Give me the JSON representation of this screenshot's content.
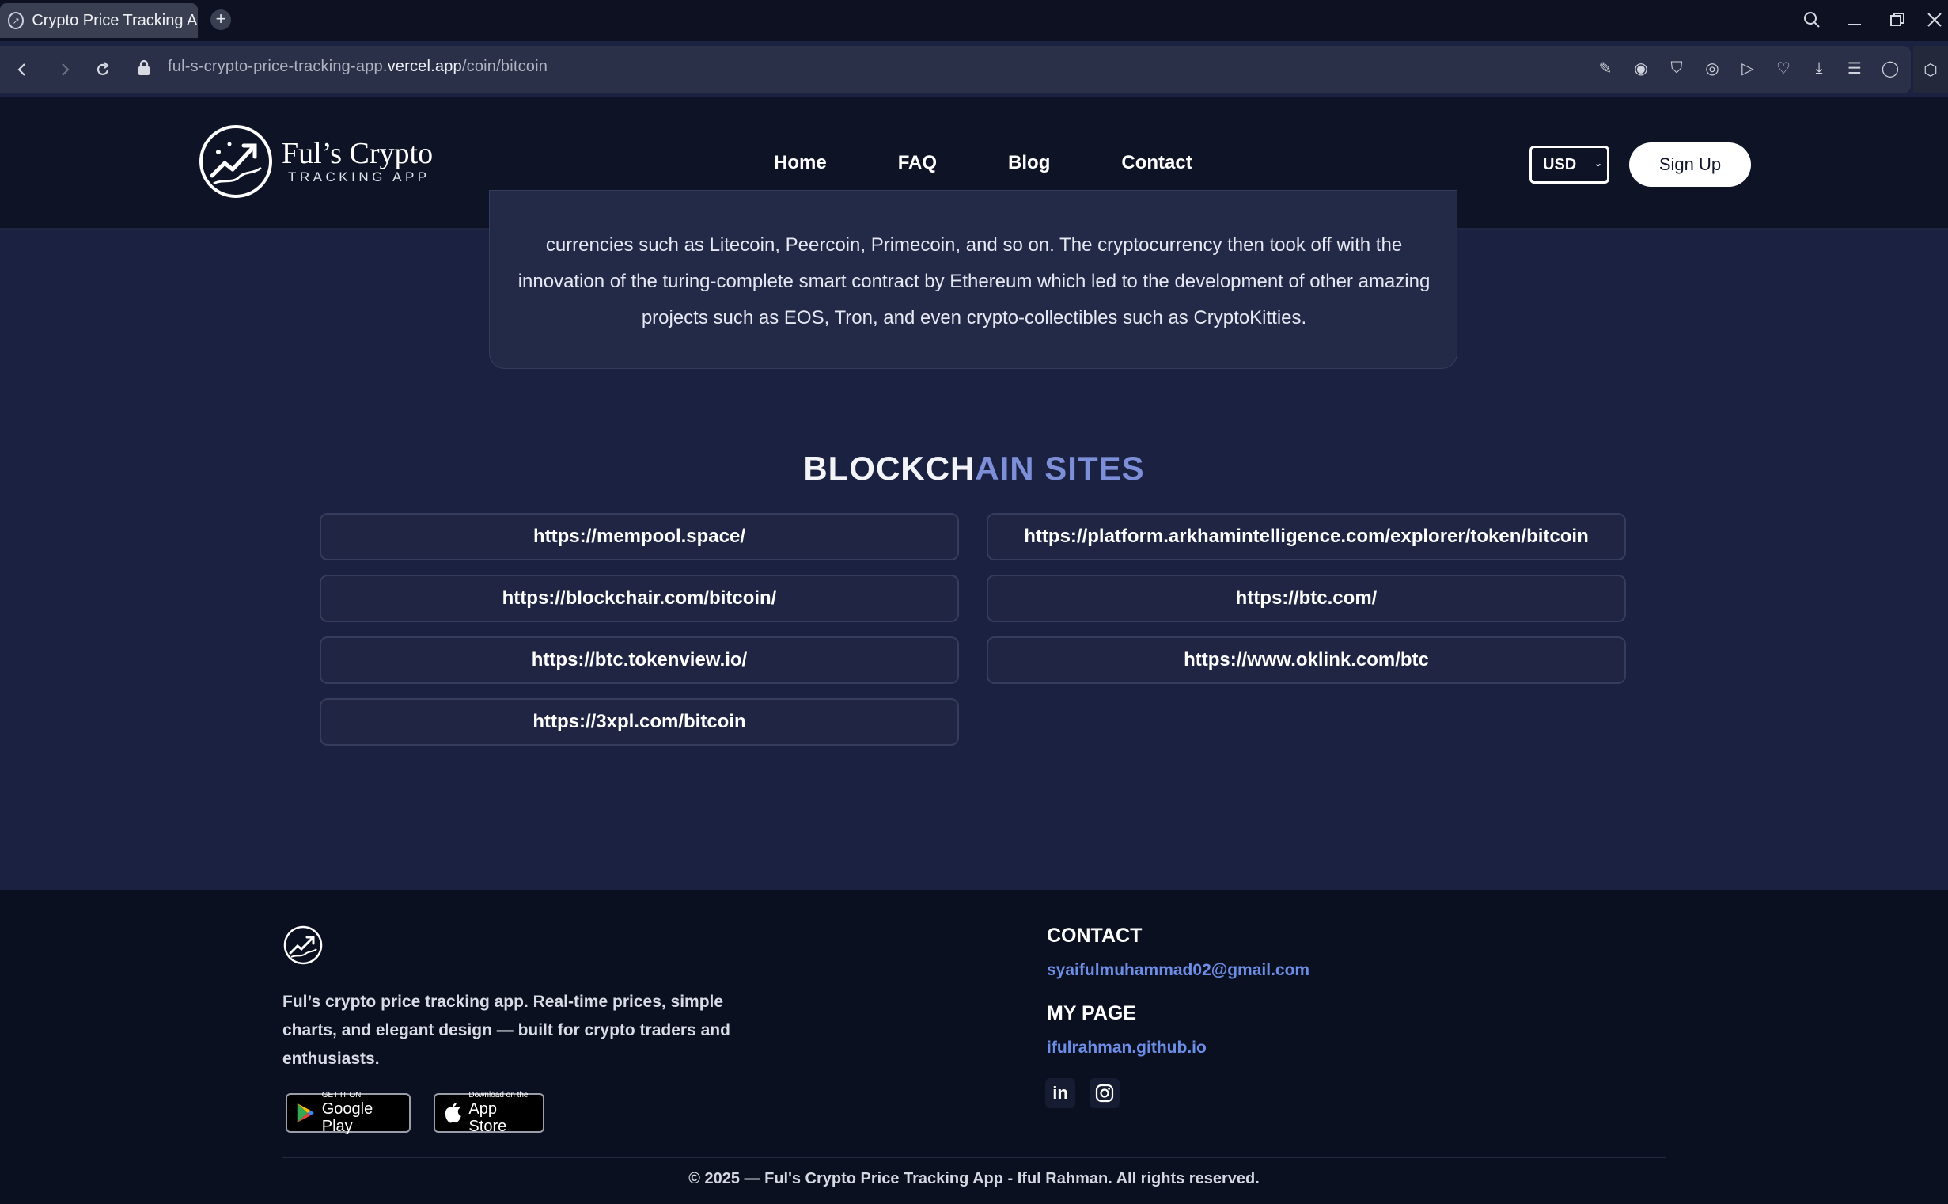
{
  "browser": {
    "tab_title": "Crypto Price Tracking App",
    "url_prefix": "ful-s-crypto-price-tracking-app.",
    "url_host": "vercel.app",
    "url_path": "/coin/bitcoin"
  },
  "header": {
    "logo_name": "Ful’s Crypto",
    "logo_sub": "TRACKING APP",
    "nav": [
      "Home",
      "FAQ",
      "Blog",
      "Contact"
    ],
    "currency": "USD",
    "signup": "Sign Up"
  },
  "description": {
    "text": "currencies such as Litecoin, Peercoin, Primecoin, and so on. The cryptocurrency then took off with the innovation of the turing-complete smart contract by Ethereum which led to the development of other amazing projects such as EOS, Tron, and even crypto-collectibles such as CryptoKitties."
  },
  "blockchain": {
    "title_part1": "BLOCKCH",
    "title_part2": "AIN SITES",
    "links": [
      "https://mempool.space/",
      "https://platform.arkhamintelligence.com/explorer/token/bitcoin",
      "https://blockchair.com/bitcoin/",
      "https://btc.com/",
      "https://btc.tokenview.io/",
      "https://www.oklink.com/btc",
      "https://3xpl.com/bitcoin"
    ]
  },
  "footer": {
    "description": "Ful’s crypto price tracking app. Real-time prices, simple charts, and elegant design — built for crypto traders and enthusiasts.",
    "google_small": "GET IT ON",
    "google_big": "Google Play",
    "apple_small": "Download on the",
    "apple_big": "App Store",
    "contact_heading": "CONTACT",
    "contact_email": "syaifulmuhammad02@gmail.com",
    "mypage_heading": "MY PAGE",
    "mypage_link": "ifulrahman.github.io",
    "social": [
      "in",
      "instagram-icon"
    ],
    "copyright": "© 2025 — Ful's Crypto Price Tracking App - Iful Rahman. All rights reserved."
  },
  "colors": {
    "background": "#1b2140",
    "header": "#0e1326",
    "accent": "#7d8fd8",
    "link": "#6d8ee6"
  }
}
